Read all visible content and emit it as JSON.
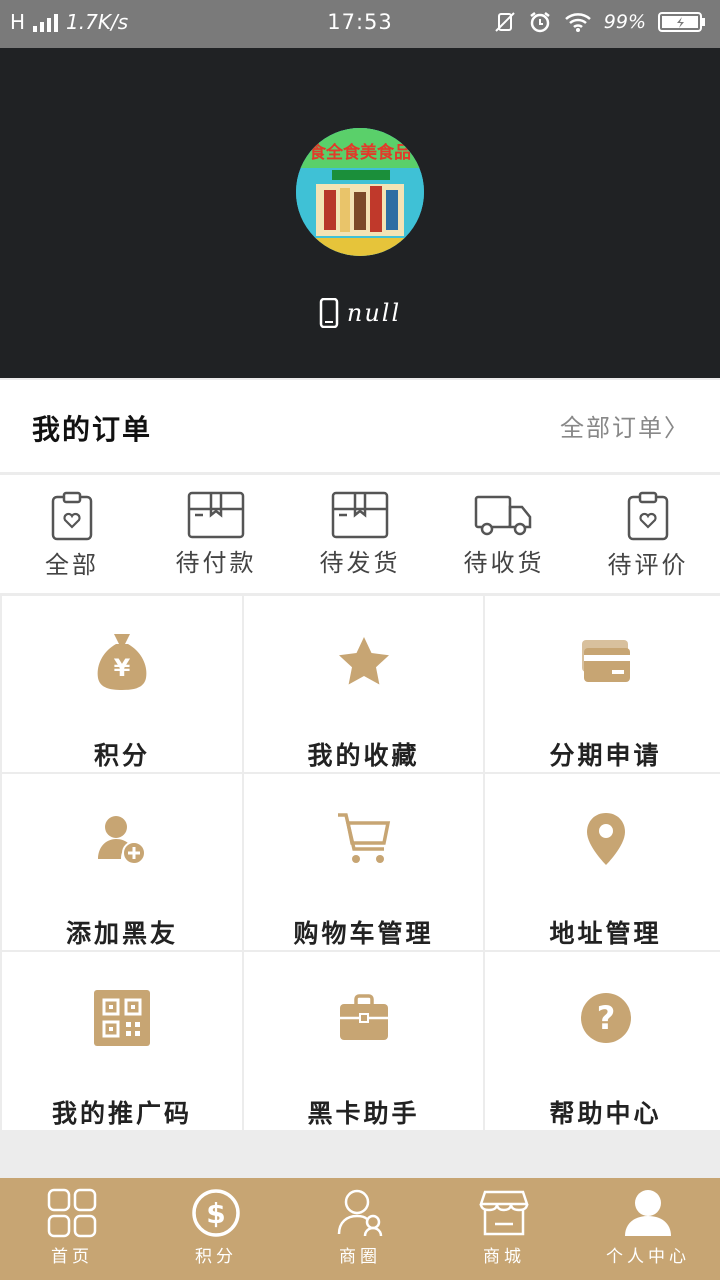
{
  "status_bar": {
    "network": "H",
    "speed": "1.7K/s",
    "time": "17:53",
    "battery": "99%"
  },
  "profile": {
    "phone_text": "null",
    "avatar_banner_text": "食全食美食品"
  },
  "orders": {
    "title": "我的订单",
    "all_orders": "全部订单〉",
    "items": [
      {
        "label": "全部",
        "icon": "clipboard-heart-icon"
      },
      {
        "label": "待付款",
        "icon": "box-icon"
      },
      {
        "label": "待发货",
        "icon": "box-icon"
      },
      {
        "label": "待收货",
        "icon": "truck-icon"
      },
      {
        "label": "待评价",
        "icon": "clipboard-heart-icon"
      }
    ]
  },
  "menu": {
    "items": [
      {
        "label": "积分",
        "icon": "money-bag-icon"
      },
      {
        "label": "我的收藏",
        "icon": "star-icon"
      },
      {
        "label": "分期申请",
        "icon": "credit-card-icon"
      },
      {
        "label": "添加黑友",
        "icon": "add-user-icon"
      },
      {
        "label": "购物车管理",
        "icon": "cart-icon"
      },
      {
        "label": "地址管理",
        "icon": "location-pin-icon"
      },
      {
        "label": "我的推广码",
        "icon": "qr-code-icon"
      },
      {
        "label": "黑卡助手",
        "icon": "briefcase-icon"
      },
      {
        "label": "帮助中心",
        "icon": "question-icon"
      }
    ]
  },
  "tabbar": {
    "items": [
      {
        "label": "首页",
        "icon": "grid-icon"
      },
      {
        "label": "积分",
        "icon": "dollar-icon"
      },
      {
        "label": "商圈",
        "icon": "people-icon"
      },
      {
        "label": "商城",
        "icon": "store-icon"
      },
      {
        "label": "个人中心",
        "icon": "person-icon"
      }
    ]
  },
  "colors": {
    "accent": "#c7a573",
    "header_bg": "#202224",
    "status_bg": "#7a7a7a"
  }
}
